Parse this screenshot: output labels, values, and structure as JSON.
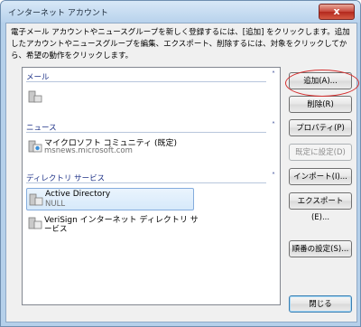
{
  "window": {
    "title": "インターネット アカウント",
    "close_glyph": "x"
  },
  "description": "電子メール アカウントやニュースグループを新しく登録するには、[追加] をクリックします。追加したアカウントやニュースグループを編集、エクスポート、削除するには、対象をクリックしてから、希望の動作をクリックします。",
  "groups": [
    {
      "label": "メール",
      "collapse_glyph": "˄",
      "items": []
    },
    {
      "label": "ニュース",
      "collapse_glyph": "˄",
      "items": [
        {
          "name": "マイクロソフト コミュニティ (既定)",
          "sub": "msnews.microsoft.com"
        }
      ]
    },
    {
      "label": "ディレクトリ サービス",
      "collapse_glyph": "˄",
      "items": [
        {
          "name": "Active Directory",
          "sub": "NULL"
        },
        {
          "name": "VeriSign インターネット ディレクトリ サ",
          "sub": "ービス"
        }
      ]
    }
  ],
  "buttons": {
    "add": "追加(A)...",
    "delete": "削除(R)",
    "properties": "プロパティ(P)",
    "set_default": "既定に設定(D)",
    "import": "インポート(I)...",
    "export": "エクスポート(E)...",
    "order": "順番の設定(S)...",
    "close": "閉じる"
  },
  "colors": {
    "accent_ring": "#d43030",
    "group_header": "#1e3287",
    "selection": "#d6e9fa"
  }
}
